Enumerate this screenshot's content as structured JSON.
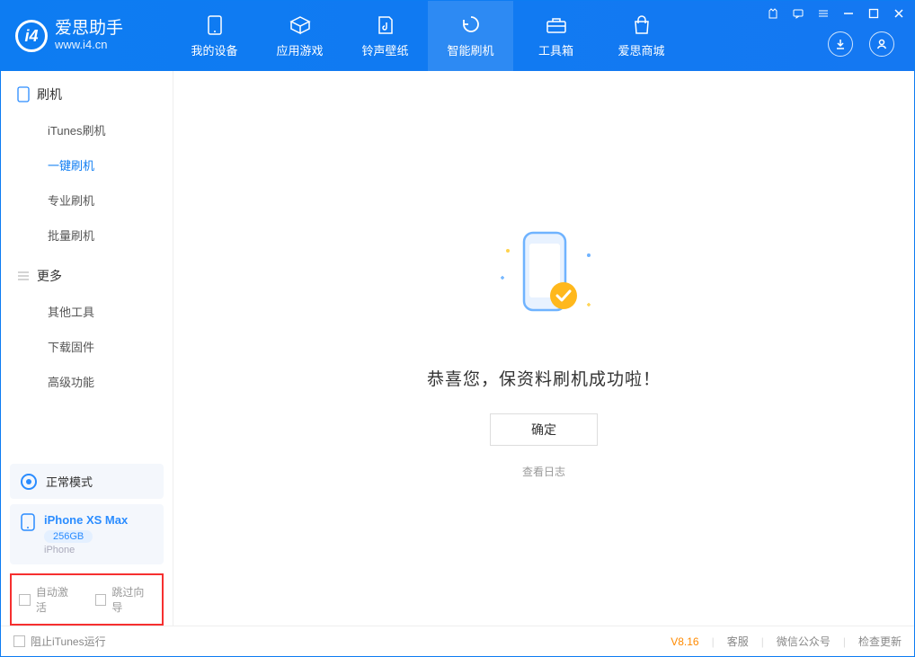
{
  "app": {
    "name_cn": "爱思助手",
    "url": "www.i4.cn"
  },
  "tabs": [
    {
      "label": "我的设备"
    },
    {
      "label": "应用游戏"
    },
    {
      "label": "铃声壁纸"
    },
    {
      "label": "智能刷机"
    },
    {
      "label": "工具箱"
    },
    {
      "label": "爱思商城"
    }
  ],
  "sidebar": {
    "group1": {
      "title": "刷机",
      "items": [
        {
          "label": "iTunes刷机"
        },
        {
          "label": "一键刷机"
        },
        {
          "label": "专业刷机"
        },
        {
          "label": "批量刷机"
        }
      ]
    },
    "group2": {
      "title": "更多",
      "items": [
        {
          "label": "其他工具"
        },
        {
          "label": "下载固件"
        },
        {
          "label": "高级功能"
        }
      ]
    },
    "mode": "正常模式",
    "device": {
      "name": "iPhone XS Max",
      "storage": "256GB",
      "type": "iPhone"
    },
    "chk1": "自动激活",
    "chk2": "跳过向导"
  },
  "main": {
    "title": "恭喜您，保资料刷机成功啦！",
    "ok": "确定",
    "log": "查看日志"
  },
  "footer": {
    "block_itunes": "阻止iTunes运行",
    "version": "V8.16",
    "service": "客服",
    "wechat": "微信公众号",
    "update": "检查更新"
  }
}
